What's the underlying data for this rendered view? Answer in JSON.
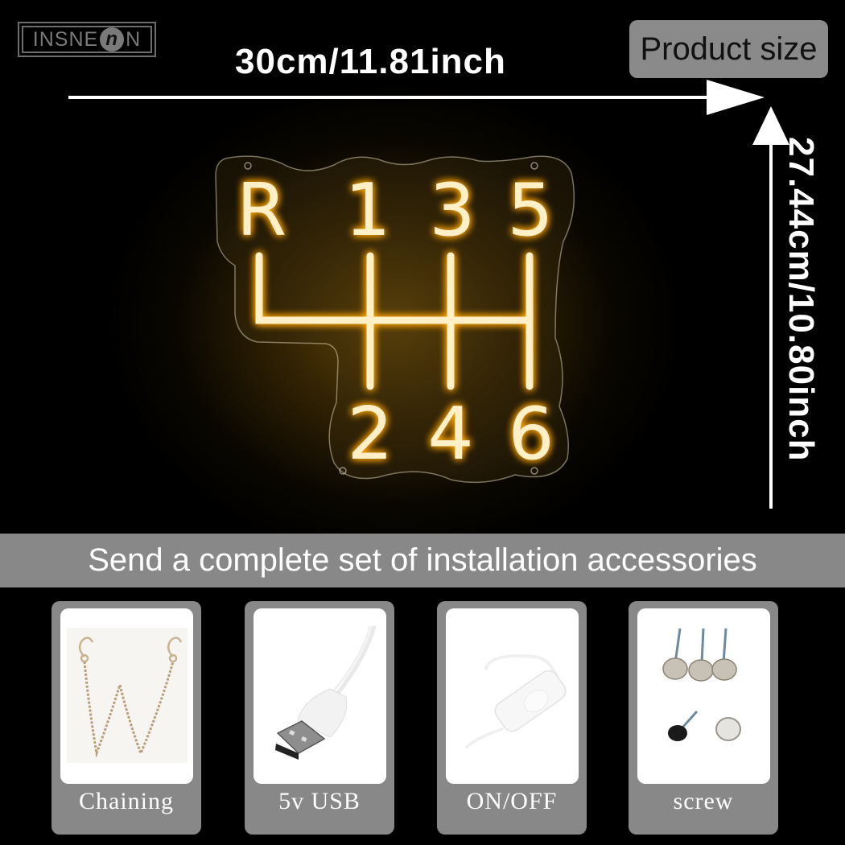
{
  "brand": {
    "logo_text_left": "INSNE",
    "logo_mark": "n",
    "logo_text_right": "N"
  },
  "dimensions": {
    "width_label": "30cm/11.81inch",
    "height_label": "27.44cm/10.80inch",
    "badge": "Product size"
  },
  "sign": {
    "top_row": [
      "R",
      "1",
      "3",
      "5"
    ],
    "bottom_row": [
      "2",
      "4",
      "6"
    ],
    "glow_color": "#ffb020",
    "tube_color": "#ffeec0"
  },
  "banner": {
    "text": "Send a complete set of installation accessories"
  },
  "accessories": [
    {
      "label": "Chaining",
      "icon": "chain-icon"
    },
    {
      "label": "5v USB",
      "icon": "usb-plug-icon"
    },
    {
      "label": "ON/OFF",
      "icon": "switch-icon"
    },
    {
      "label": "screw",
      "icon": "screw-icon"
    }
  ]
}
